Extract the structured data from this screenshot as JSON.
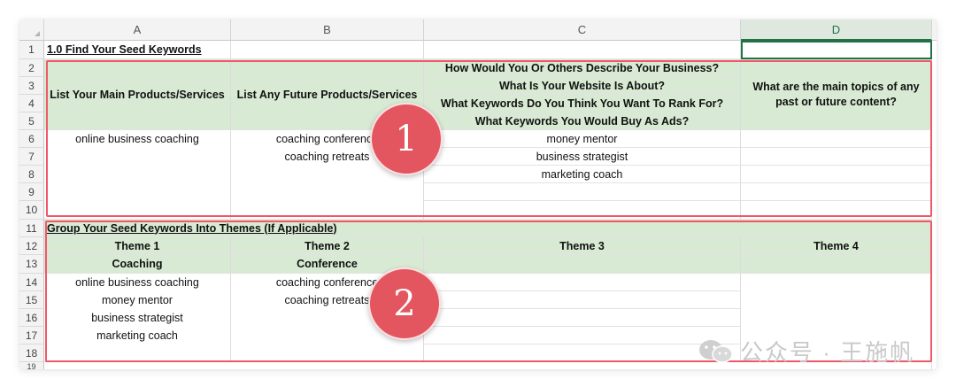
{
  "columns": [
    "A",
    "B",
    "C",
    "D"
  ],
  "rows": [
    "1",
    "2",
    "3",
    "4",
    "5",
    "6",
    "7",
    "8",
    "9",
    "10",
    "11",
    "12",
    "13",
    "14",
    "15",
    "16",
    "17",
    "18"
  ],
  "row19_partial": "19",
  "section1": {
    "title": "1.0 Find Your Seed Keywords",
    "col_a_header": "List Your Main Products/Services",
    "col_b_header": "List Any Future Products/Services",
    "col_c_questions": [
      "How Would You Or Others Describe Your Business?",
      "What Is Your Website Is About?",
      "What Keywords Do You Think You Want To Rank For?",
      "What Keywords You Would Buy As Ads?"
    ],
    "col_d_header": "What are the main topics of any past or future content?",
    "col_a_values": [
      "online business coaching"
    ],
    "col_b_values": [
      "coaching conference",
      "coaching retreats"
    ],
    "col_c_values": [
      "money mentor",
      "business strategist",
      "marketing coach"
    ]
  },
  "section2": {
    "title": "Group Your Seed Keywords Into Themes (If Applicable)",
    "themes": [
      "Theme 1",
      "Theme 2",
      "Theme 3",
      "Theme 4"
    ],
    "theme_names": [
      "Coaching",
      "Conference",
      "",
      ""
    ],
    "theme1_values": [
      "online business coaching",
      "money mentor",
      "business strategist",
      "marketing coach"
    ],
    "theme2_values": [
      "coaching conference",
      "coaching retreats"
    ]
  },
  "badges": [
    "1",
    "2"
  ],
  "watermark": "公众号 · 王施帆",
  "colors": {
    "header_green": "#d8ead3",
    "highlight": "#f0586a",
    "badge": "#e4565f"
  }
}
